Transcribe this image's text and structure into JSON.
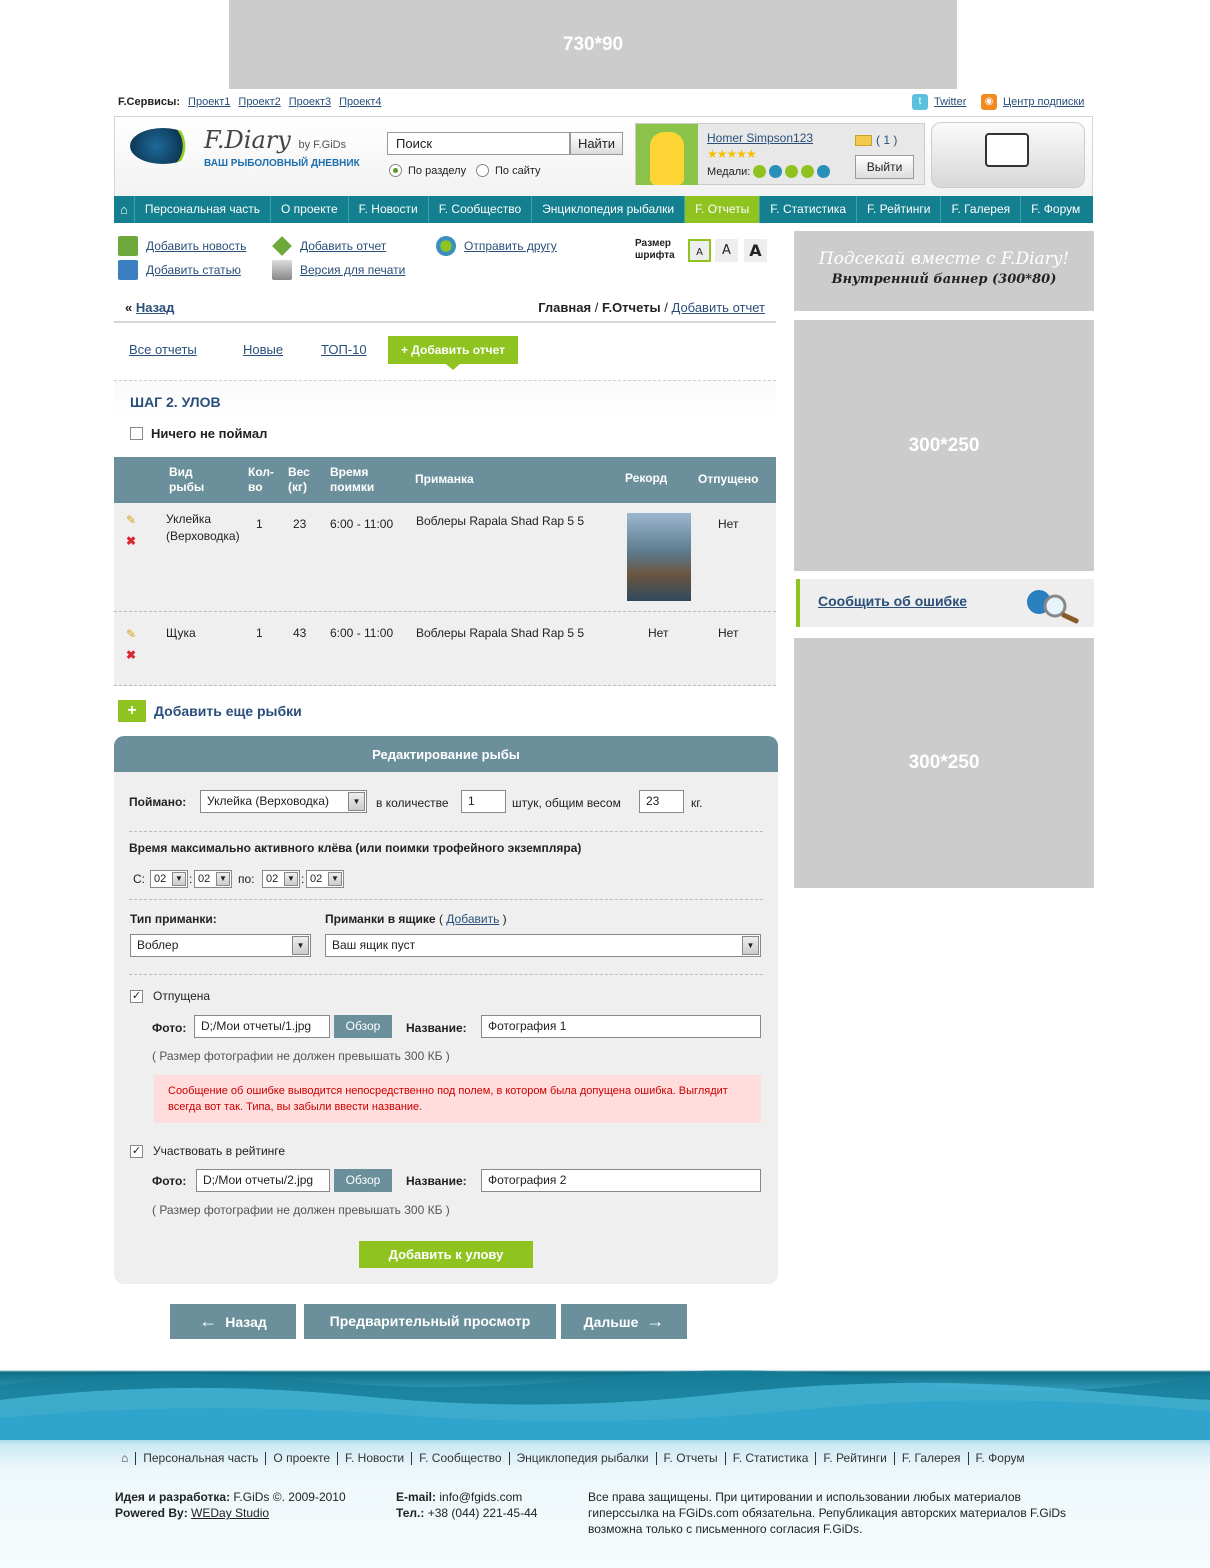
{
  "top_banner": "730*90",
  "services": {
    "label": "F.Сервисы:",
    "items": [
      "Проект1",
      "Проект2",
      "Проект3",
      "Проект4"
    ],
    "twitter": "Twitter",
    "subscribe": "Центр подписки"
  },
  "logo": {
    "title": "F.Diary",
    "by": "by F.GiDs",
    "tagline": "ВАШ РЫБОЛОВНЫЙ ДНЕВНИК"
  },
  "search": {
    "value": "Поиск",
    "button": "Найти",
    "opt1": "По разделу",
    "opt2": "По сайту"
  },
  "user": {
    "name": "Homer Simpson123",
    "stars": "★★★★★",
    "medals_label": "Медали:",
    "mail_count": "( 1 )",
    "exit": "Выйти"
  },
  "nav": {
    "home": "⌂",
    "items": [
      "Персональная часть",
      "О проекте",
      "F. Новости",
      "F. Сообщество",
      "Энциклопедия рыбалки",
      "F. Отчеты",
      "F. Статистика",
      "F. Рейтинги",
      "F. Галерея",
      "F. Форум"
    ],
    "active": "F. Отчеты"
  },
  "tools": {
    "add_news": "Добавить новость",
    "add_report": "Добавить отчет",
    "send_friend": "Отправить другу",
    "add_article": "Добавить статью",
    "print": "Версия для печати",
    "font_size": "Размер шрифта",
    "font_a": "A"
  },
  "crumbs": {
    "back_prefix": "«",
    "back": "Назад",
    "home": "Главная",
    "sep": "/",
    "reports": "F.Отчеты",
    "current": "Добавить отчет"
  },
  "tabs": {
    "all": "Все отчеты",
    "new": "Новые",
    "top": "ТОП-10",
    "add": "+ Добавить отчет"
  },
  "step": {
    "title": "ШАГ 2. УЛОВ",
    "nothing": "Ничего не поймал"
  },
  "table": {
    "headers": {
      "kind": "Вид рыбы",
      "qty": "Кол-во",
      "weight": "Вес (кг)",
      "time": "Время поимки",
      "bait": "Приманка",
      "record": "Рекорд",
      "released": "Отпущено"
    },
    "rows": [
      {
        "kind": "Уклейка (Верховодка)",
        "qty": "1",
        "weight": "23",
        "time": "6:00 - 11:00",
        "bait": "Воблеры Rapala Shad Rap 5 5",
        "record": "",
        "released": "Нет"
      },
      {
        "kind": "Щука",
        "qty": "1",
        "weight": "43",
        "time": "6:00 - 11:00",
        "bait": "Воблеры Rapala Shad Rap 5 5",
        "record": "Нет",
        "released": "Нет"
      }
    ]
  },
  "add_more": "Добавить еще рыбки",
  "edit": {
    "title": "Редактирование рыбы",
    "caught_label": "Поймано:",
    "fish_value": "Уклейка (Верховодка)",
    "in_qty": "в количестве",
    "qty_value": "1",
    "total_weight": "штук, общим весом",
    "weight_value": "23",
    "kg": "кг.",
    "time_title": "Время максимально активного клёва (или поимки трофейного экземпляра)",
    "from": "С:",
    "to": "по:",
    "colon": ":",
    "t1": "02",
    "t2": "02",
    "t3": "02",
    "t4": "02",
    "bait_type_label": "Тип приманки:",
    "bait_type_value": "Воблер",
    "box_label": "Приманки в ящике",
    "box_add": "Добавить",
    "box_value": "Ваш ящик пуст",
    "released": "Отпущена",
    "photo_label": "Фото:",
    "photo1": "D;/Мои отчеты/1.jpg",
    "browse": "Обзор",
    "name_label": "Название:",
    "name1": "Фотография 1",
    "size_note": "( Размер фотографии не должен превышать 300 КБ )",
    "error": "Сообщение об ошибке выводится непосредственно под полем, в котором была допущена ошибка. Выглядит всегда вот так. Типа, вы забыли ввести название.",
    "rating": "Участвовать в рейтинге",
    "photo2": "D;/Мои отчеты/2.jpg",
    "name2": "Фотография 2",
    "add_btn": "Добавить к улову"
  },
  "bottom_nav": {
    "back": "Назад",
    "preview": "Предварительный просмотр",
    "next": "Дальше"
  },
  "sidebar": {
    "banner_a": "Подсекай вместе с F.Diary!",
    "banner_b": "Внутренний баннер (300*80)",
    "ad1": "300*250",
    "report": "Сообщить об ошибке",
    "ad2": "300*250"
  },
  "footer": {
    "idea_label": "Идея и разработка:",
    "idea_value": "F.GiDs ©. 2009-2010",
    "powered_label": "Powered By:",
    "powered_value": "WEDay Studio",
    "email_label": "E-mail:",
    "email_value": "info@fgids.com",
    "phone_label": "Тел.:",
    "phone_value": "+38 (044) 221-45-44",
    "rights": "Все права защищены. При цитировании и использовании любых материалов гиперссылка на FGiDs.com обязательна. Републикация авторских материалов F.GiDs возможна только с письменного согласия F.GiDs."
  },
  "colors": {
    "green": "#8fc31f",
    "teal": "#137f8f",
    "slate": "#6b909c",
    "link": "#2a4f7a"
  }
}
